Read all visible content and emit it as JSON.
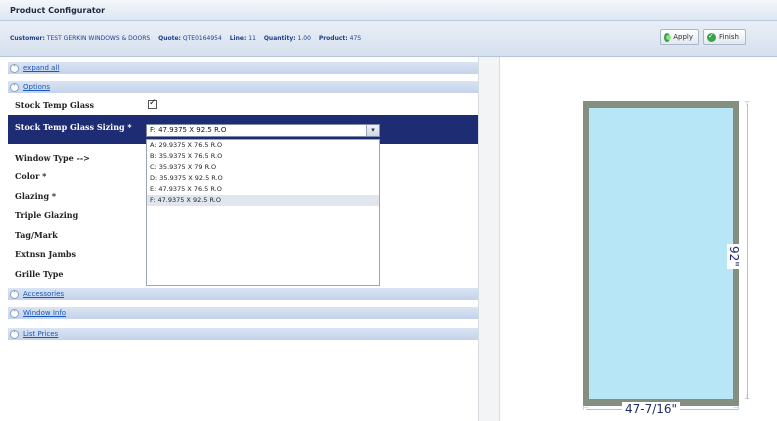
{
  "title": "Product Configurator",
  "info": {
    "customer_label": "Customer:",
    "customer_value": "TEST GERKIN WINDOWS & DOORS",
    "quote_label": "Quote:",
    "quote_value": "QTE0164954",
    "line_label": "Line:",
    "line_value": "11",
    "quantity_label": "Quantity:",
    "quantity_value": "1.00",
    "product_label": "Product:",
    "product_value": "47S"
  },
  "buttons": {
    "apply": "Apply",
    "finish": "Finish"
  },
  "sections": {
    "expand_all": "expand all",
    "options": "Options",
    "accessories": "Accessories",
    "window_info": "Window Info",
    "list_prices": "List Prices"
  },
  "options": {
    "stock_temp_glass": "Stock Temp Glass",
    "stock_temp_glass_sizing": "Stock Temp Glass Sizing *",
    "window_type": "Window Type -->",
    "color": "Color *",
    "glazing": "Glazing *",
    "triple_glazing": "Triple Glazing",
    "tag_mark": "Tag/Mark",
    "extnsn_jambs": "Extnsn Jambs",
    "grille_type": "Grille Type"
  },
  "sizing_select": {
    "selected": "F: 47.9375 X 92.5 R.O",
    "options": [
      "A: 29.9375 X 76.5 R.O",
      "B: 35.9375 X 76.5 R.O",
      "C: 35.9375 X 79 R.O",
      "D: 35.9375 X 92.5 R.O",
      "E: 47.9375 X 76.5 R.O",
      "F: 47.9375 X 92.5 R.O"
    ]
  },
  "drawing": {
    "width_label": "47-7/16\"",
    "height_label": "92\""
  }
}
